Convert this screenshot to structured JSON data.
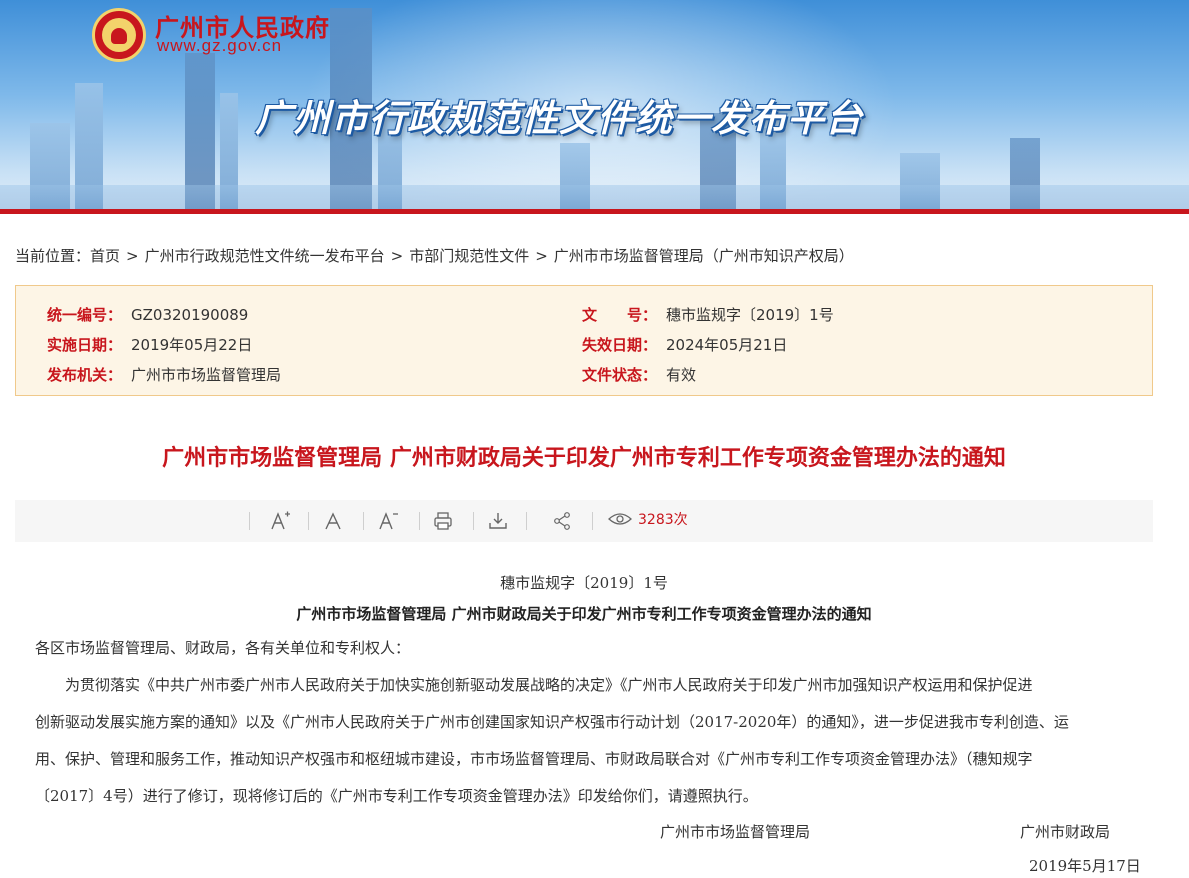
{
  "header": {
    "gov_name": "广州市人民政府",
    "gov_url": "www.gz.gov.cn",
    "platform_title": "广州市行政规范性文件统一发布平台"
  },
  "breadcrumb": {
    "prefix": "当前位置：",
    "items": [
      "首页",
      "广州市行政规范性文件统一发布平台",
      "市部门规范性文件",
      "广州市市场监督管理局（广州市知识产权局）"
    ],
    "separator": ">"
  },
  "info": {
    "serial_label": "统一编号：",
    "serial_value": "GZ0320190089",
    "doc_no_label": "文　　号：",
    "doc_no_value": "穗市监规字〔2019〕1号",
    "effective_label": "实施日期：",
    "effective_value": "2019年05月22日",
    "expiry_label": "失效日期：",
    "expiry_value": "2024年05月21日",
    "issuer_label": "发布机关：",
    "issuer_value": "广州市市场监督管理局",
    "status_label": "文件状态：",
    "status_value": "有效"
  },
  "title": "广州市市场监督管理局 广州市财政局关于印发广州市专利工作专项资金管理办法的通知",
  "toolbar": {
    "font_increase_icon": "A+",
    "font_reset_icon": "A",
    "font_decrease_icon": "A-",
    "print_icon": "printer",
    "download_icon": "download",
    "share_icon": "share",
    "views_icon": "eye",
    "views_count": "3283次"
  },
  "body": {
    "doc_number": "穗市监规字〔2019〕1号",
    "subtitle": "广州市市场监督管理局 广州市财政局关于印发广州市专利工作专项资金管理办法的通知",
    "greeting": "各区市场监督管理局、财政局，各有关单位和专利权人：",
    "paragraph_lines": [
      "　　为贯彻落实《中共广州市委广州市人民政府关于加快实施创新驱动发展战略的决定》《广州市人民政府关于印发广州市加强知识产权运用和保护促进",
      "创新驱动发展实施方案的通知》以及《广州市人民政府关于广州市创建国家知识产权强市行动计划（2017-2020年）的通知》，进一步促进我市专利创造、运",
      "用、保护、管理和服务工作，推动知识产权强市和枢纽城市建设，市市场监督管理局、市财政局联合对《广州市专利工作专项资金管理办法》（穗知规字",
      "〔2017〕4号）进行了修订，现将修订后的《广州市专利工作专项资金管理办法》印发给你们，请遵照执行。"
    ],
    "signatory_1": "广州市市场监督管理局",
    "signatory_2": "广州市财政局",
    "date": "2019年5月17日"
  },
  "colors": {
    "accent_red": "#c8161d",
    "info_bg": "#fdf5e6",
    "info_border": "#f0c98b",
    "toolbar_bg": "#f6f6f6"
  }
}
